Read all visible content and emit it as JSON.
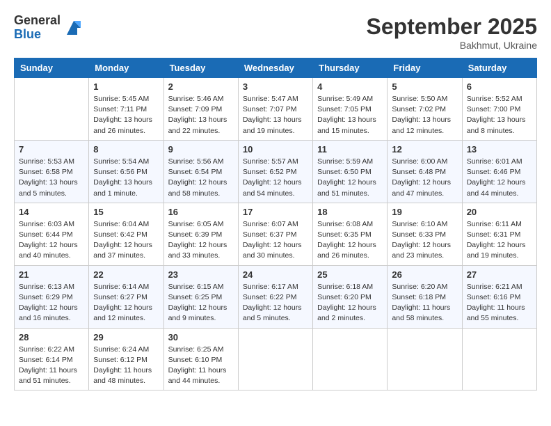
{
  "header": {
    "logo_general": "General",
    "logo_blue": "Blue",
    "month_title": "September 2025",
    "location": "Bakhmut, Ukraine"
  },
  "calendar": {
    "days_of_week": [
      "Sunday",
      "Monday",
      "Tuesday",
      "Wednesday",
      "Thursday",
      "Friday",
      "Saturday"
    ],
    "weeks": [
      [
        {
          "day": "",
          "info": ""
        },
        {
          "day": "1",
          "info": "Sunrise: 5:45 AM\nSunset: 7:11 PM\nDaylight: 13 hours\nand 26 minutes."
        },
        {
          "day": "2",
          "info": "Sunrise: 5:46 AM\nSunset: 7:09 PM\nDaylight: 13 hours\nand 22 minutes."
        },
        {
          "day": "3",
          "info": "Sunrise: 5:47 AM\nSunset: 7:07 PM\nDaylight: 13 hours\nand 19 minutes."
        },
        {
          "day": "4",
          "info": "Sunrise: 5:49 AM\nSunset: 7:05 PM\nDaylight: 13 hours\nand 15 minutes."
        },
        {
          "day": "5",
          "info": "Sunrise: 5:50 AM\nSunset: 7:02 PM\nDaylight: 13 hours\nand 12 minutes."
        },
        {
          "day": "6",
          "info": "Sunrise: 5:52 AM\nSunset: 7:00 PM\nDaylight: 13 hours\nand 8 minutes."
        }
      ],
      [
        {
          "day": "7",
          "info": "Sunrise: 5:53 AM\nSunset: 6:58 PM\nDaylight: 13 hours\nand 5 minutes."
        },
        {
          "day": "8",
          "info": "Sunrise: 5:54 AM\nSunset: 6:56 PM\nDaylight: 13 hours\nand 1 minute."
        },
        {
          "day": "9",
          "info": "Sunrise: 5:56 AM\nSunset: 6:54 PM\nDaylight: 12 hours\nand 58 minutes."
        },
        {
          "day": "10",
          "info": "Sunrise: 5:57 AM\nSunset: 6:52 PM\nDaylight: 12 hours\nand 54 minutes."
        },
        {
          "day": "11",
          "info": "Sunrise: 5:59 AM\nSunset: 6:50 PM\nDaylight: 12 hours\nand 51 minutes."
        },
        {
          "day": "12",
          "info": "Sunrise: 6:00 AM\nSunset: 6:48 PM\nDaylight: 12 hours\nand 47 minutes."
        },
        {
          "day": "13",
          "info": "Sunrise: 6:01 AM\nSunset: 6:46 PM\nDaylight: 12 hours\nand 44 minutes."
        }
      ],
      [
        {
          "day": "14",
          "info": "Sunrise: 6:03 AM\nSunset: 6:44 PM\nDaylight: 12 hours\nand 40 minutes."
        },
        {
          "day": "15",
          "info": "Sunrise: 6:04 AM\nSunset: 6:42 PM\nDaylight: 12 hours\nand 37 minutes."
        },
        {
          "day": "16",
          "info": "Sunrise: 6:05 AM\nSunset: 6:39 PM\nDaylight: 12 hours\nand 33 minutes."
        },
        {
          "day": "17",
          "info": "Sunrise: 6:07 AM\nSunset: 6:37 PM\nDaylight: 12 hours\nand 30 minutes."
        },
        {
          "day": "18",
          "info": "Sunrise: 6:08 AM\nSunset: 6:35 PM\nDaylight: 12 hours\nand 26 minutes."
        },
        {
          "day": "19",
          "info": "Sunrise: 6:10 AM\nSunset: 6:33 PM\nDaylight: 12 hours\nand 23 minutes."
        },
        {
          "day": "20",
          "info": "Sunrise: 6:11 AM\nSunset: 6:31 PM\nDaylight: 12 hours\nand 19 minutes."
        }
      ],
      [
        {
          "day": "21",
          "info": "Sunrise: 6:13 AM\nSunset: 6:29 PM\nDaylight: 12 hours\nand 16 minutes."
        },
        {
          "day": "22",
          "info": "Sunrise: 6:14 AM\nSunset: 6:27 PM\nDaylight: 12 hours\nand 12 minutes."
        },
        {
          "day": "23",
          "info": "Sunrise: 6:15 AM\nSunset: 6:25 PM\nDaylight: 12 hours\nand 9 minutes."
        },
        {
          "day": "24",
          "info": "Sunrise: 6:17 AM\nSunset: 6:22 PM\nDaylight: 12 hours\nand 5 minutes."
        },
        {
          "day": "25",
          "info": "Sunrise: 6:18 AM\nSunset: 6:20 PM\nDaylight: 12 hours\nand 2 minutes."
        },
        {
          "day": "26",
          "info": "Sunrise: 6:20 AM\nSunset: 6:18 PM\nDaylight: 11 hours\nand 58 minutes."
        },
        {
          "day": "27",
          "info": "Sunrise: 6:21 AM\nSunset: 6:16 PM\nDaylight: 11 hours\nand 55 minutes."
        }
      ],
      [
        {
          "day": "28",
          "info": "Sunrise: 6:22 AM\nSunset: 6:14 PM\nDaylight: 11 hours\nand 51 minutes."
        },
        {
          "day": "29",
          "info": "Sunrise: 6:24 AM\nSunset: 6:12 PM\nDaylight: 11 hours\nand 48 minutes."
        },
        {
          "day": "30",
          "info": "Sunrise: 6:25 AM\nSunset: 6:10 PM\nDaylight: 11 hours\nand 44 minutes."
        },
        {
          "day": "",
          "info": ""
        },
        {
          "day": "",
          "info": ""
        },
        {
          "day": "",
          "info": ""
        },
        {
          "day": "",
          "info": ""
        }
      ]
    ]
  }
}
